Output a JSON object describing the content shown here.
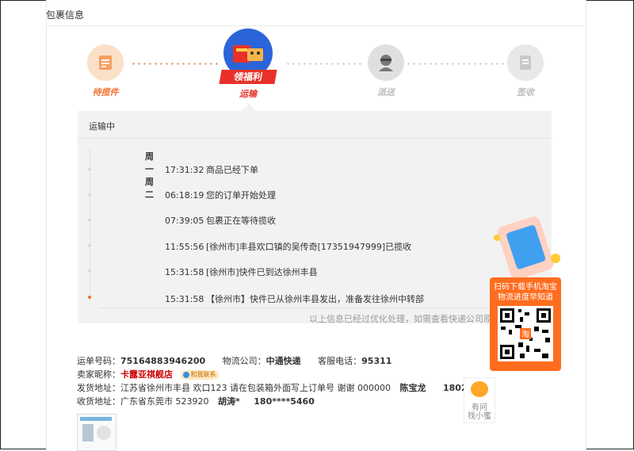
{
  "header": {
    "title": "包裹信息"
  },
  "steps": [
    {
      "label": "待揽件",
      "state": "done"
    },
    {
      "label": "运输",
      "state": "current",
      "banner": "领福利"
    },
    {
      "label": "派送",
      "state": "pending"
    },
    {
      "label": "签收",
      "state": "pending"
    }
  ],
  "tracking": {
    "status": "运输中",
    "weekdays": [
      "周一",
      "周二"
    ],
    "events": [
      {
        "time": "17:31:32",
        "text": "商品已经下单"
      },
      {
        "time": "06:18:19",
        "text": "您的订单开始处理"
      },
      {
        "time": "07:39:05",
        "text": "包裹正在等待揽收"
      },
      {
        "time": "11:55:56",
        "text": "[徐州市]丰县欢口镇的吴传奇[17351947999]已揽收"
      },
      {
        "time": "15:31:58",
        "text": "[徐州市]快件已到达徐州丰县"
      },
      {
        "time": "15:31:58",
        "text": "【徐州市】快件已从徐州丰县发出，准备发往徐州中转部"
      }
    ],
    "footnote": "以上信息已经过优化处理，如需查看快递公司原"
  },
  "shipment": {
    "waybill_label": "运单号码：",
    "waybill": "75164883946200",
    "carrier_label": "物流公司：",
    "carrier": "中通快递",
    "phone_label": "客服电话：",
    "phone": "95311",
    "seller_label": "卖家昵称：",
    "seller": "卡露亚祺舰店",
    "contact": "和我联系",
    "from_label": "发货地址：",
    "from_address": "江苏省徐州市丰县 欢口123 请在包装箱外面写上订单号 谢谢 000000",
    "from_name": "陈宝龙",
    "from_phone": "18020",
    "to_label": "收货地址：",
    "to_address": "广东省东莞市 523920",
    "to_name": "胡涛*",
    "to_phone": "180****5460"
  },
  "promo": {
    "line1": "扫码下载手机淘宝",
    "line2": "物流进度早知道",
    "badge": "淘"
  },
  "help": {
    "line1": "有问",
    "line2": "找小蜜"
  },
  "colors": {
    "accent": "#ff6d1e",
    "active_step": "#e8312a",
    "done_step": "#f5a060"
  }
}
